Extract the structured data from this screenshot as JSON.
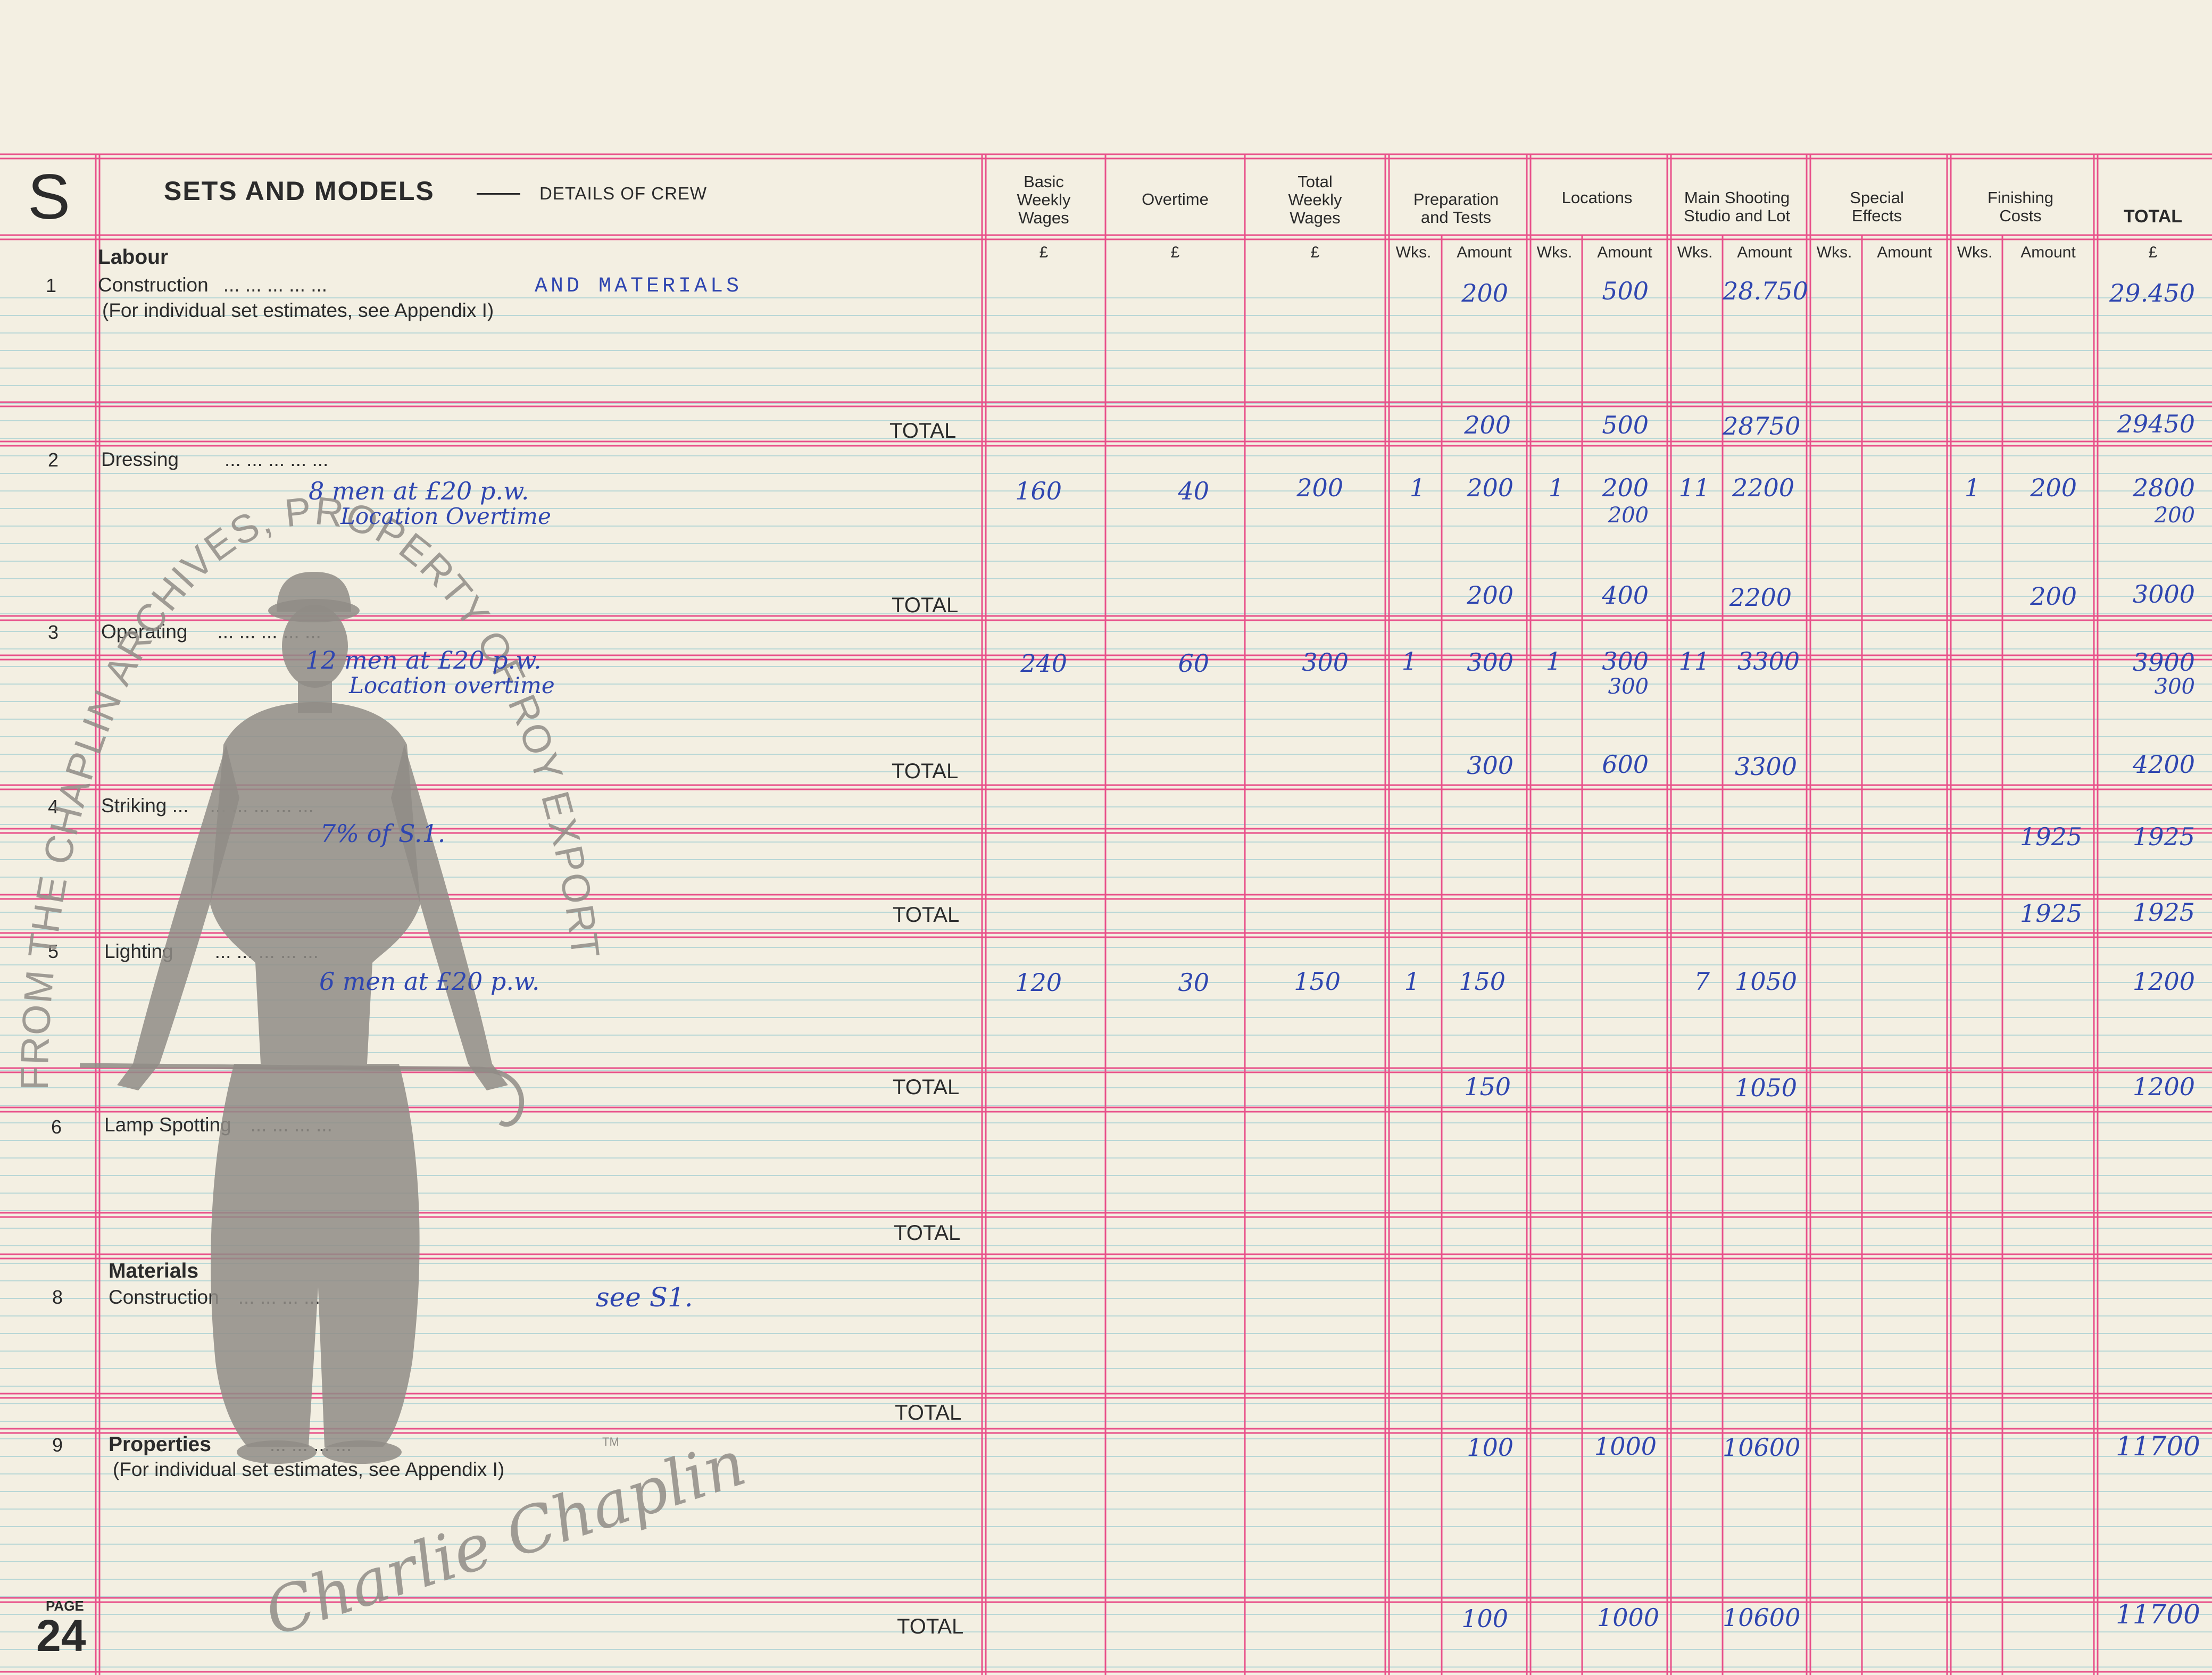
{
  "section_letter": "S",
  "title": "SETS AND MODELS",
  "subtitle": "DETAILS OF CREW",
  "page_label": "PAGE",
  "page_number": "24",
  "columns": {
    "basic": "Basic\nWeekly\nWages",
    "overtime": "Overtime",
    "total_weekly": "Total\nWeekly\nWages",
    "prep": "Preparation\nand Tests",
    "locations": "Locations",
    "main": "Main Shooting\nStudio and Lot",
    "special": "Special\nEffects",
    "finishing": "Finishing\nCosts",
    "total": "TOTAL"
  },
  "sub": {
    "pound": "£",
    "wks": "Wks.",
    "amount": "Amount"
  },
  "labels": {
    "labour": "Labour",
    "construction": "Construction",
    "appendix": "(For individual set estimates, see Appendix I)",
    "dressing": "Dressing",
    "operating": "Operating",
    "striking": "Striking ...",
    "lighting": "Lighting",
    "lamp": "Lamp Spotting",
    "materials": "Materials",
    "construction2": "Construction",
    "properties": "Properties",
    "appendix2": "(For individual set estimates, see Appendix I)",
    "total": "TOTAL",
    "dots": "...     ...     ...     ...     ...",
    "dots_short": "...     ...     ...     ..."
  },
  "row_numbers": [
    "1",
    "2",
    "3",
    "4",
    "5",
    "6",
    "8",
    "9"
  ],
  "handwriting": {
    "r1_note": "AND MATERIALS",
    "r1_prep": "200",
    "r1_loc": "500",
    "r1_main": "28.750",
    "r1_total": "29.450",
    "r1t_prep": "200",
    "r1t_loc": "500",
    "r1t_main": "28750",
    "r1t_total": "29450",
    "r2_note1": "8 men at £20 p.w.",
    "r2_note2": "Location Overtime",
    "r2_basic": "160",
    "r2_over": "40",
    "r2_totw": "200",
    "r2_pwks": "1",
    "r2_prep": "200",
    "r2_lwks": "1",
    "r2_loc": "200",
    "r2_loc2": "200",
    "r2_mwks": "11",
    "r2_main": "2200",
    "r2_fwks": "1",
    "r2_fin": "200",
    "r2_total": "2800",
    "r2_total2": "200",
    "r2t_prep": "200",
    "r2t_loc": "400",
    "r2t_main": "2200",
    "r2t_fin": "200",
    "r2t_total": "3000",
    "r3_note1": "12 men at £20 p.w.",
    "r3_note2": "Location overtime",
    "r3_basic": "240",
    "r3_over": "60",
    "r3_totw": "300",
    "r3_pwks": "1",
    "r3_prep": "300",
    "r3_lwks": "1",
    "r3_loc": "300",
    "r3_loc2": "300",
    "r3_mwks": "11",
    "r3_main": "3300",
    "r3_total": "3900",
    "r3_total2": "300",
    "r3t_prep": "300",
    "r3t_loc": "600",
    "r3t_main": "3300",
    "r3t_total": "4200",
    "r4_note": "7% of S.1.",
    "r4_fin": "1925",
    "r4_total": "1925",
    "r4t_fin": "1925",
    "r4t_total": "1925",
    "r5_note": "6 men at £20 p.w.",
    "r5_basic": "120",
    "r5_over": "30",
    "r5_totw": "150",
    "r5_pwks": "1",
    "r5_prep": "150",
    "r5_mwks": "7",
    "r5_main": "1050",
    "r5_total": "1200",
    "r5t_prep": "150",
    "r5t_main": "1050",
    "r5t_total": "1200",
    "r8_note": "see S1.",
    "r9_prep": "100",
    "r9_loc": "1000",
    "r9_main": "10600",
    "r9_total": "11700",
    "r9t_prep": "100",
    "r9t_loc": "1000",
    "r9t_main": "10600",
    "r9t_total": "11700"
  },
  "watermark": "FROM THE CHAPLIN ARCHIVES, PROPERTY OF ROY EXPORT",
  "signature": "Charlie Chaplin",
  "trademark": "TM",
  "colors": {
    "paper": "#f3efe2",
    "rule": "#e8508a",
    "faint": "#b9d7d6",
    "ink": "#2f46b0",
    "print": "#2b2b2b",
    "watermark": "#8f8c86"
  }
}
